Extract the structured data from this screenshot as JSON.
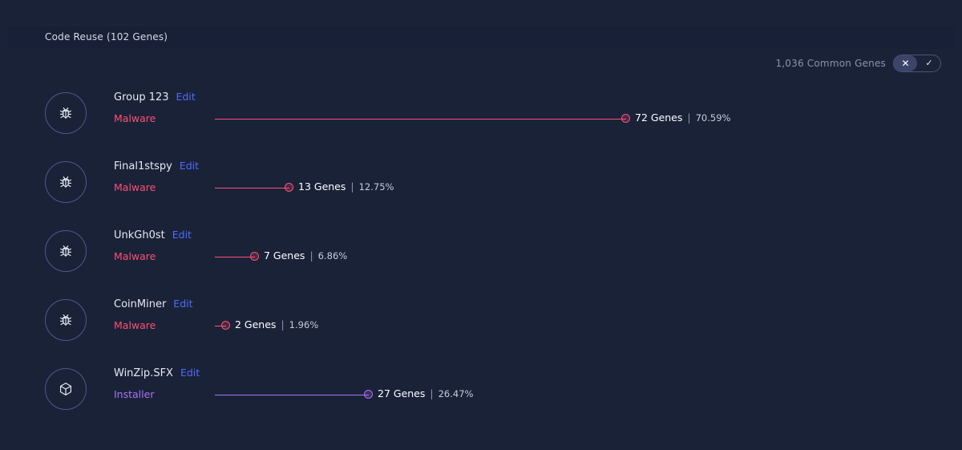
{
  "header": {
    "title": "Code Reuse",
    "count": "(102 Genes)"
  },
  "common_genes": {
    "label": "1,036 Common Genes",
    "toggle_off": "✕",
    "toggle_on": "✓"
  },
  "colors": {
    "malware": "#ff4f73",
    "installer": "#a873f5",
    "edit": "#4f6bff",
    "background": "#1a2238"
  },
  "edit_label": "Edit",
  "items": [
    {
      "name": "Group 123",
      "category": "Malware",
      "icon": "bug-icon",
      "genes": "72 Genes",
      "percent": "70.59%",
      "fraction": 0.7059
    },
    {
      "name": "Final1stspy",
      "category": "Malware",
      "icon": "bug-icon",
      "genes": "13 Genes",
      "percent": "12.75%",
      "fraction": 0.1275
    },
    {
      "name": "UnkGh0st",
      "category": "Malware",
      "icon": "bug-icon",
      "genes": "7 Genes",
      "percent": "6.86%",
      "fraction": 0.0686
    },
    {
      "name": "CoinMiner",
      "category": "Malware",
      "icon": "bug-icon",
      "genes": "2 Genes",
      "percent": "1.96%",
      "fraction": 0.0196
    },
    {
      "name": "WinZip.SFX",
      "category": "Installer",
      "icon": "package-icon",
      "genes": "27 Genes",
      "percent": "26.47%",
      "fraction": 0.2647
    }
  ]
}
